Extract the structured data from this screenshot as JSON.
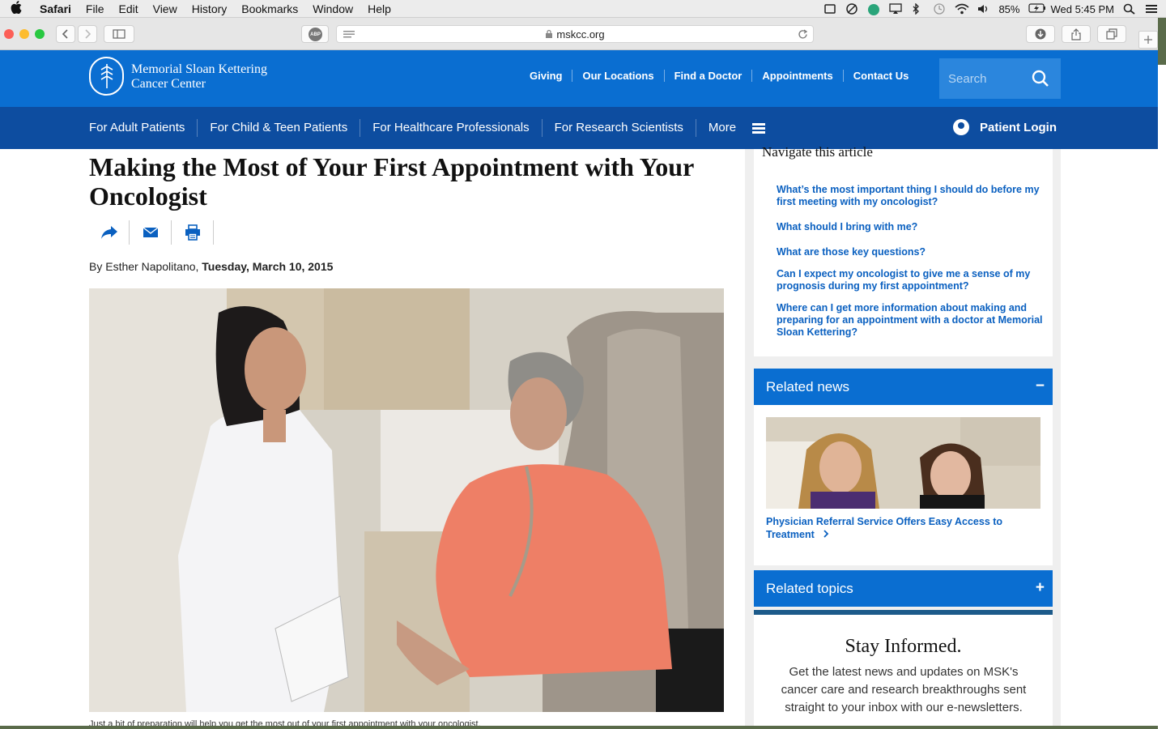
{
  "menubar": {
    "app": "Safari",
    "items": [
      "File",
      "Edit",
      "View",
      "History",
      "Bookmarks",
      "Window",
      "Help"
    ],
    "battery": "85%",
    "clock": "Wed 5:45 PM"
  },
  "browser": {
    "url": "mskcc.org",
    "adblock_label": "ABP"
  },
  "site": {
    "logo_line1": "Memorial Sloan Kettering",
    "logo_line2": "Cancer Center",
    "top_links": [
      "Giving",
      "Our Locations",
      "Find a Doctor",
      "Appointments",
      "Contact Us"
    ],
    "search_placeholder": "Search",
    "main_nav": [
      "For Adult Patients",
      "For Child & Teen Patients",
      "For Healthcare Professionals",
      "For Research Scientists",
      "More"
    ],
    "patient_login": "Patient Login"
  },
  "article": {
    "title": "Making the Most of Your First Appointment with Your Oncologist",
    "byline_prefix": "By Esther Napolitano,",
    "date": "Tuesday, March 10, 2015",
    "caption": "Just a bit of preparation will help you get the most out of your first appointment with your oncologist."
  },
  "sidebar": {
    "navigate_title": "Navigate this article",
    "navigate_links": [
      "What’s the most important thing I should do before my first meeting with my oncologist?",
      "What should I bring with me?",
      "What are those key questions?",
      "Can I expect my oncologist to give me a sense of my prognosis during my first appointment?",
      "Where can I get more information about making and preparing for an appointment with a doctor at Memorial Sloan Kettering?"
    ],
    "related_news_title": "Related news",
    "related_news_toggle": "−",
    "related_news_link": "Physician Referral Service Offers Easy Access to Treatment",
    "related_topics_title": "Related topics",
    "related_topics_toggle": "+",
    "stay_title": "Stay Informed.",
    "stay_text": "Get the latest news and updates on MSK's cancer care and research breakthroughs sent straight to your inbox with our e-newsletters."
  },
  "colors": {
    "header_blue": "#0a6ed1",
    "nav_dark_blue": "#0d4da0",
    "link_blue": "#0a60c0"
  }
}
